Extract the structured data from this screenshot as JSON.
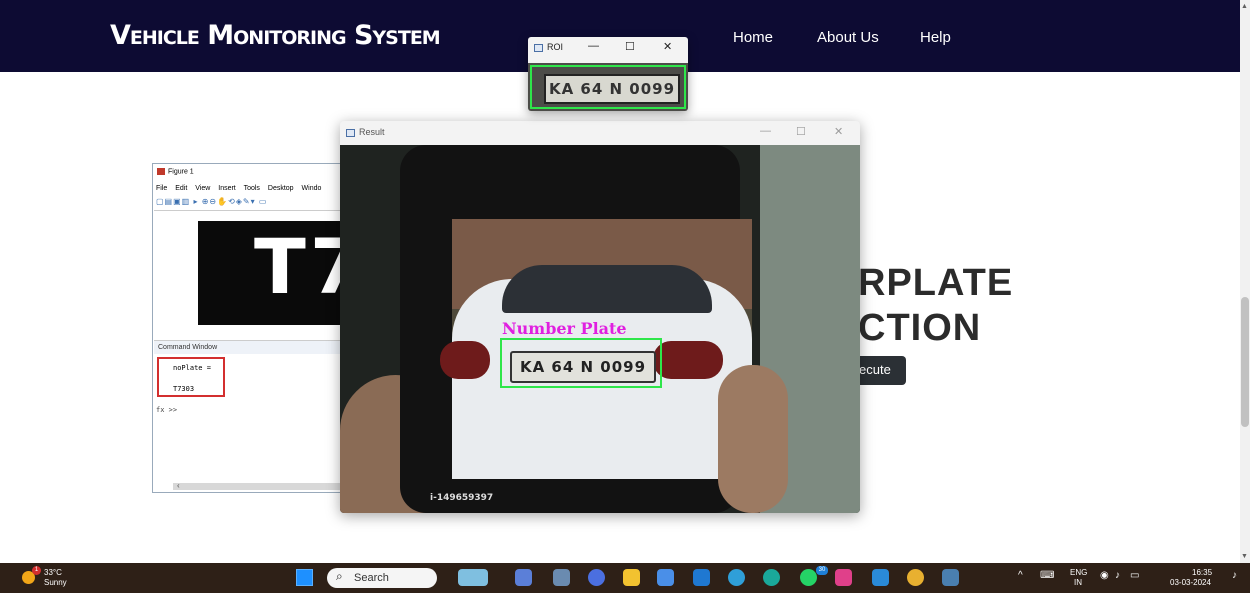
{
  "website": {
    "brand": "Vehicle Monitoring System",
    "nav": [
      "Home",
      "About Us",
      "Help"
    ],
    "hero_line1": "RPLATE",
    "hero_line2": "CTION",
    "execute_button": "ecute"
  },
  "matlab_figure": {
    "title": "Figure 1",
    "menu": [
      "File",
      "Edit",
      "View",
      "Insert",
      "Tools",
      "Desktop",
      "Windo"
    ],
    "plate_text": "T7",
    "command_window_title": "Command Window",
    "command_var": "noPlate =",
    "command_value": "T7303",
    "prompt": "fx >>"
  },
  "result_window": {
    "title": "Result",
    "controls": [
      "—",
      "☐",
      "✕"
    ],
    "annotation_label": "Number Plate",
    "plate_text": "KA 64 N 0099",
    "bottom_text": "i-149659397"
  },
  "roi_window": {
    "title": "ROI",
    "controls": [
      "—",
      "☐",
      "✕"
    ],
    "plate_text": "KA 64 N 0099"
  },
  "taskbar": {
    "weather_temp": "33°C",
    "weather_condition": "Sunny",
    "weather_badge": "1",
    "search_placeholder": "Search",
    "badge_count": "30",
    "language_top": "ENG",
    "language_bottom": "IN",
    "time": "16:35",
    "date": "03-03-2024",
    "icons": [
      "start-icon",
      "copilot-icon",
      "teams-icon",
      "files-icon",
      "meet-icon",
      "file-explorer-icon",
      "store-icon",
      "mail-icon",
      "chrome-edge-icon",
      "photos-icon",
      "whatsapp-icon",
      "gallery-icon",
      "vscode-icon",
      "chrome-icon",
      "python-icon"
    ]
  },
  "colors": {
    "navbar": "#0d0b33",
    "detection_box": "#2ee64a",
    "annotation_text": "#e020e0",
    "taskbar": "#2e2017"
  }
}
